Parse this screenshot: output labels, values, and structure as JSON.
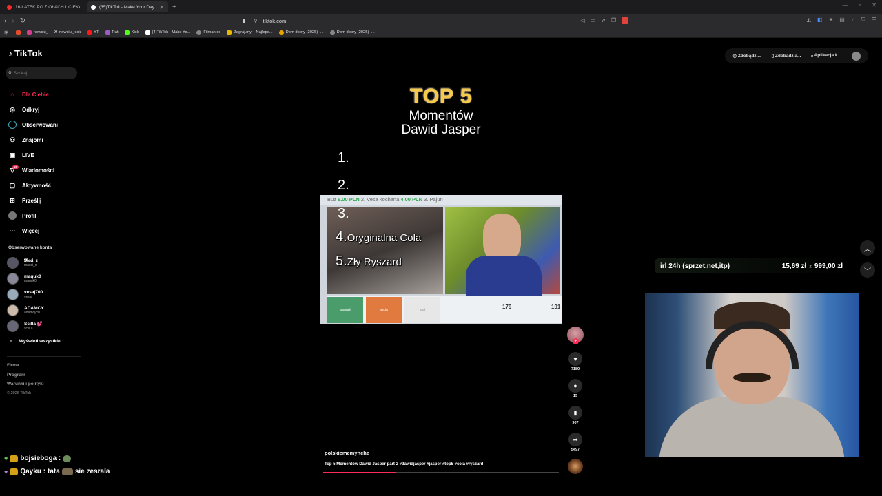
{
  "browser": {
    "tabs": [
      {
        "label": "16-LATEK PO ZIOŁACH UCIEKAŁ PO",
        "active": false
      },
      {
        "label": "(35)TikTok - Make Your Day",
        "active": true
      }
    ],
    "url": "tiktok.com",
    "bookmarks": [
      "nowciu_",
      "nowciu_kick",
      "YT",
      "Rat",
      "Kick",
      "(4)TikTok - Make Yo...",
      "Filman.cc",
      "Zagraj.my – Najleps...",
      "Dom dobry (2025) -...",
      "Dom dobry (2025) -..."
    ]
  },
  "tiktok": {
    "logo": "TikTok",
    "search_placeholder": "Szukaj",
    "menu": [
      {
        "label": "Dla Ciebie",
        "icon": "home-icon",
        "active": true
      },
      {
        "label": "Odkryj",
        "icon": "compass-icon"
      },
      {
        "label": "Obserwowani",
        "icon": "following-icon"
      },
      {
        "label": "Znajomi",
        "icon": "friends-icon"
      },
      {
        "label": "LIVE",
        "icon": "live-icon"
      },
      {
        "label": "Wiadomości",
        "icon": "messages-icon",
        "badge": "59"
      },
      {
        "label": "Aktywność",
        "icon": "activity-icon"
      },
      {
        "label": "Prześlij",
        "icon": "upload-icon"
      },
      {
        "label": "Profil",
        "icon": "profile-icon"
      },
      {
        "label": "Więcej",
        "icon": "more-icon"
      }
    ],
    "followed_title": "Obserwowane konta",
    "accounts": [
      {
        "name": "𝕸𝖆𝖈𝖎_𝖝",
        "handle": "maxci_x"
      },
      {
        "name": "maquk0",
        "handle": "maquk0"
      },
      {
        "name": "vesaj700",
        "handle": "vesaj"
      },
      {
        "name": "ADAMCY",
        "handle": "adamcyxd"
      },
      {
        "name": "Scilla 💕",
        "handle": "scill.a"
      }
    ],
    "show_all": "Wyświetl wszystkie",
    "footer": [
      "Firma",
      "Program",
      "Warunki i polityki"
    ],
    "copyright": "© 2026 TikTok",
    "top_buttons": [
      "Zdobądź ...",
      "Zdobądź a...",
      "Aplikacja k..."
    ],
    "video": {
      "title_top": "TOP 5",
      "title_line1": "Momentów",
      "title_line2": "Dawid Jasper",
      "ranks": [
        "1.",
        "2.",
        "3.",
        "4.",
        "5."
      ],
      "rank4_text": "Oryginalna Cola",
      "rank5_text": "Zły Ryszard",
      "clip_strip_prefix": "Buz",
      "clip_strip_price": "6.00 PLN",
      "clip_strip_mid": "2. Vesa kochana",
      "clip_strip_price2": "4.00 PLN",
      "clip_strip_end": "3. Pajun",
      "clip_btn1": "wspraś",
      "clip_btn2": "akcja",
      "clip_btn3": "kraj",
      "clip_num1": "179",
      "clip_num2": "191",
      "author": "polskiememyhehe",
      "description": "Top 5 Momentów Dawid Jasper part 2 #dawidjasper #jasper #top5 #cola #ryszard",
      "progress": 0.31,
      "likes": "7180",
      "comments": "15",
      "saves": "907",
      "shares": "5497"
    }
  },
  "stream": {
    "donation_label": "irl 24h (sprzet,net,itp)",
    "donation_current": "15,69 zł",
    "donation_sep": "z",
    "donation_goal": "999,00 zł",
    "chat": [
      {
        "user": "bojsieboga :",
        "message": "",
        "heart_color": "#5ec85e"
      },
      {
        "user": "Qayku :",
        "message": "tata",
        "message2": "sie zesrala",
        "heart_color": "#a889e6"
      }
    ]
  }
}
